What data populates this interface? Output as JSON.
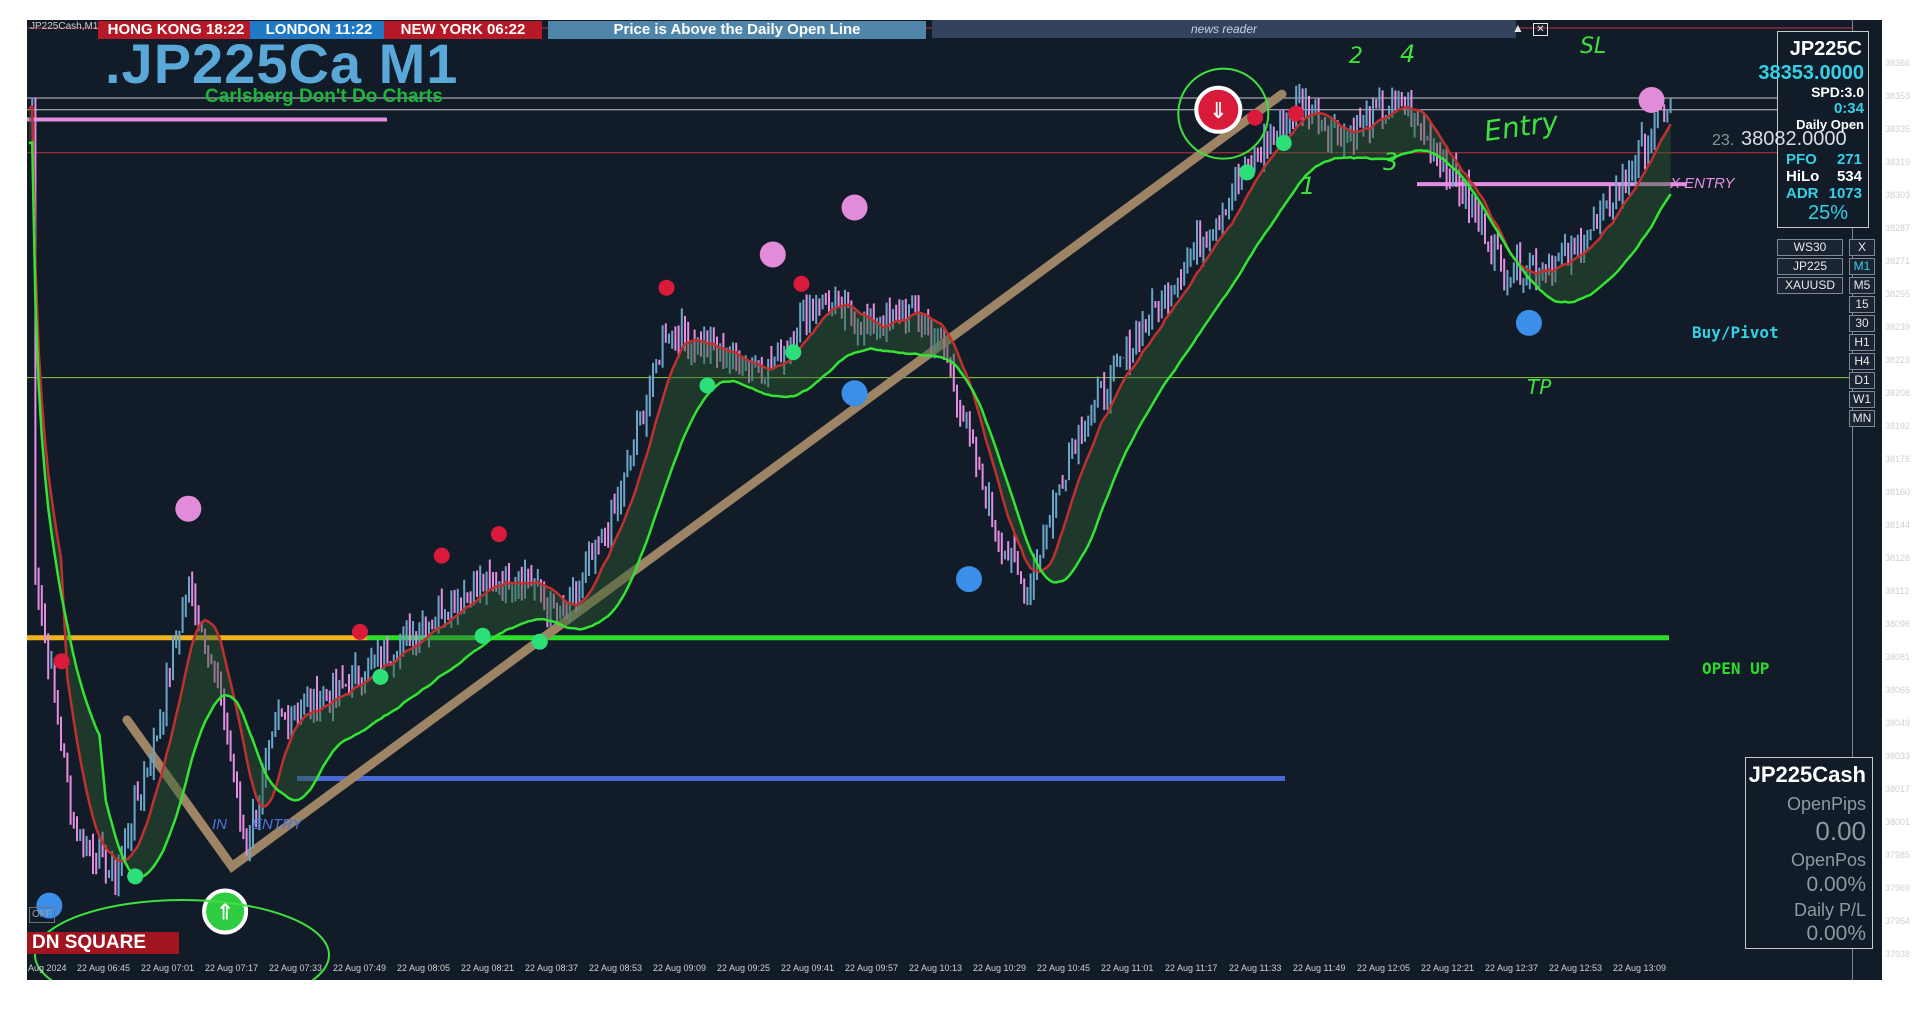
{
  "header": {
    "small_title": "JP225Cash,M1",
    "sessions": [
      {
        "label": "HONG KONG 18:22",
        "color": "#b51826"
      },
      {
        "label": "LONDON  11:22",
        "color": "#1f79c4"
      },
      {
        "label": "NEW YORK 06:22",
        "color": "#b51826"
      }
    ],
    "banner": "Price is Above the Daily Open Line",
    "banner_bg": "#4f85a8",
    "chart_title": ".JP225Ca M1",
    "subtitle": "Carlsberg Don't Do Charts",
    "news_reader": "news reader"
  },
  "info_panel": {
    "symbol": "JP225C",
    "price": "38353.0000",
    "spread": "SPD:3.0",
    "timer": "0:34",
    "daily_open_label": "Daily Open",
    "daily_open_value": "38082.0000",
    "open_prefix": "23.",
    "pfo_label": "PFO",
    "pfo_value": "271",
    "hilo_label": "HiLo",
    "hilo_value": "534",
    "adr_label": "ADR",
    "adr_value": "1073",
    "pct": "25%"
  },
  "symbols": {
    "items": [
      {
        "label": "WS30",
        "side": "X"
      },
      {
        "label": "JP225",
        "side": "M1"
      },
      {
        "label": "XAUUSD",
        "side": "M5"
      }
    ],
    "timeframes": [
      "15",
      "30",
      "H1",
      "H4",
      "D1",
      "W1",
      "MN"
    ]
  },
  "position_panel": {
    "symbol": "JP225Cash",
    "open_pips_label": "OpenPips",
    "open_pips_value": "0.00",
    "open_pos_label": "OpenPos",
    "open_pos_value": "0.00%",
    "daily_pl_label": "Daily P/L",
    "daily_pl_value": "0.00%"
  },
  "chart_labels": {
    "open_up": "OPEN UP",
    "buy_pivot": "Buy/Pivot",
    "dn_square": "DN SQUARE",
    "off_btn": "OFF",
    "x_entry": "X ENTRY",
    "in_entry": "IN      ENTRY"
  },
  "annotations": {
    "sl": "SL",
    "entry": "Entry",
    "tp": "TP",
    "n1": "1",
    "n2": "2",
    "n3": "3",
    "n4": "4"
  },
  "price_axis": [
    "38366",
    "38353",
    "38335",
    "38319",
    "38303",
    "38287",
    "38271",
    "38255",
    "38239",
    "38223",
    "38208",
    "38192",
    "38176",
    "38160",
    "38144",
    "38128",
    "38112",
    "38096",
    "38081",
    "38065",
    "38049",
    "38033",
    "38017",
    "38001",
    "37985",
    "37969",
    "37954",
    "37938"
  ],
  "time_axis": [
    "Aug 2024",
    "22 Aug 06:45",
    "22 Aug 07:01",
    "22 Aug 07:17",
    "22 Aug 07:33",
    "22 Aug 07:49",
    "22 Aug 08:05",
    "22 Aug 08:21",
    "22 Aug 08:37",
    "22 Aug 08:53",
    "22 Aug 09:09",
    "22 Aug 09:25",
    "22 Aug 09:41",
    "22 Aug 09:57",
    "22 Aug 10:13",
    "22 Aug 10:29",
    "22 Aug 10:45",
    "22 Aug 11:01",
    "22 Aug 11:17",
    "22 Aug 11:33",
    "22 Aug 11:49",
    "22 Aug 12:05",
    "22 Aug 12:21",
    "22 Aug 12:37",
    "22 Aug 12:53",
    "22 Aug 13:09"
  ],
  "colors": {
    "background": "#121c29",
    "up_bar": "#6aa6c9",
    "down_bar": "#e58de0",
    "daily_open_line": "#2bdc2b",
    "ma_fast": "#c03030",
    "ma_slow": "#33e433",
    "trend_line": "#9c8464"
  },
  "chart_data": {
    "type": "candlestick",
    "symbol": "JP225Cash",
    "timeframe": "M1",
    "x_range": [
      "22 Aug 06:30",
      "22 Aug 13:11"
    ],
    "y_range": [
      37930,
      38380
    ],
    "daily_open": 38082,
    "current_price": 38353,
    "price_path": [
      {
        "t": "06:30",
        "p": 38125
      },
      {
        "t": "06:40",
        "p": 37985
      },
      {
        "t": "06:50",
        "p": 37960
      },
      {
        "t": "07:00",
        "p": 38030
      },
      {
        "t": "07:08",
        "p": 38110
      },
      {
        "t": "07:15",
        "p": 38060
      },
      {
        "t": "07:22",
        "p": 37975
      },
      {
        "t": "07:30",
        "p": 38040
      },
      {
        "t": "07:45",
        "p": 38055
      },
      {
        "t": "08:00",
        "p": 38080
      },
      {
        "t": "08:15",
        "p": 38105
      },
      {
        "t": "08:30",
        "p": 38115
      },
      {
        "t": "08:40",
        "p": 38090
      },
      {
        "t": "08:53",
        "p": 38150
      },
      {
        "t": "09:05",
        "p": 38240
      },
      {
        "t": "09:20",
        "p": 38225
      },
      {
        "t": "09:30",
        "p": 38220
      },
      {
        "t": "09:42",
        "p": 38255
      },
      {
        "t": "09:55",
        "p": 38240
      },
      {
        "t": "10:05",
        "p": 38250
      },
      {
        "t": "10:13",
        "p": 38230
      },
      {
        "t": "10:25",
        "p": 38140
      },
      {
        "t": "10:33",
        "p": 38105
      },
      {
        "t": "10:45",
        "p": 38185
      },
      {
        "t": "11:00",
        "p": 38235
      },
      {
        "t": "11:17",
        "p": 38290
      },
      {
        "t": "11:30",
        "p": 38330
      },
      {
        "t": "11:40",
        "p": 38355
      },
      {
        "t": "11:50",
        "p": 38340
      },
      {
        "t": "12:05",
        "p": 38355
      },
      {
        "t": "12:20",
        "p": 38310
      },
      {
        "t": "12:30",
        "p": 38270
      },
      {
        "t": "12:45",
        "p": 38275
      },
      {
        "t": "12:55",
        "p": 38300
      },
      {
        "t": "13:09",
        "p": 38353
      }
    ]
  }
}
